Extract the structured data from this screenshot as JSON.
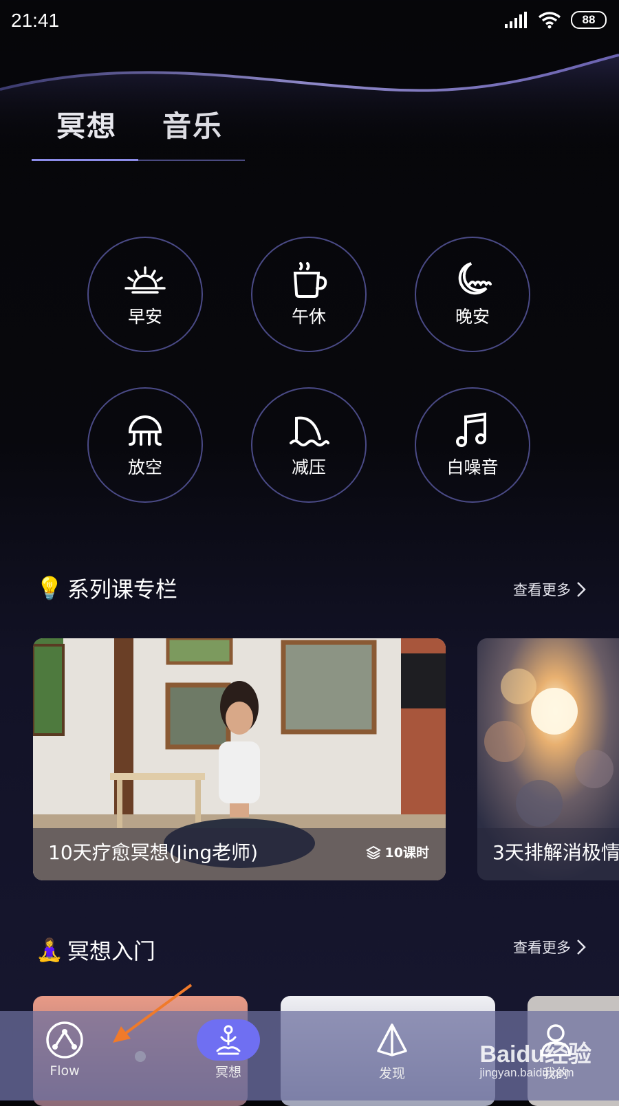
{
  "status_bar": {
    "time": "21:41",
    "battery": "88"
  },
  "tabs": [
    {
      "label": "冥想",
      "active": true
    },
    {
      "label": "音乐",
      "active": false
    }
  ],
  "scenes": [
    {
      "label": "早安",
      "icon": "sunrise-icon"
    },
    {
      "label": "午休",
      "icon": "coffee-cup-icon"
    },
    {
      "label": "晚安",
      "icon": "moon-clouds-icon"
    },
    {
      "label": "放空",
      "icon": "jellyfish-icon"
    },
    {
      "label": "减压",
      "icon": "wave-icon"
    },
    {
      "label": "白噪音",
      "icon": "music-note-icon"
    }
  ],
  "series_section": {
    "emoji": "💡",
    "title": "系列课专栏",
    "see_more": "查看更多",
    "cards": [
      {
        "title": "10天疗愈冥想(Jing老师)",
        "lessons": "10课时"
      },
      {
        "title": "3天排解消极情"
      }
    ]
  },
  "intro_section": {
    "emoji": "🧘‍♀️",
    "title": "冥想入门",
    "see_more": "查看更多"
  },
  "bottom_nav": [
    {
      "label": "Flow",
      "icon": "flow-icon",
      "active": false
    },
    {
      "label": "冥想",
      "icon": "meditation-icon",
      "active": true
    },
    {
      "label": "发现",
      "icon": "discover-icon",
      "active": false
    },
    {
      "label": "我的",
      "icon": "profile-icon",
      "active": false
    }
  ],
  "watermark": {
    "line1": "Baidu经验",
    "line2": "jingyan.baidu.com"
  },
  "colors": {
    "accent": "#6f6ff2",
    "circle_border": "#4a4a86",
    "annotation_arrow": "#f07a2a"
  }
}
